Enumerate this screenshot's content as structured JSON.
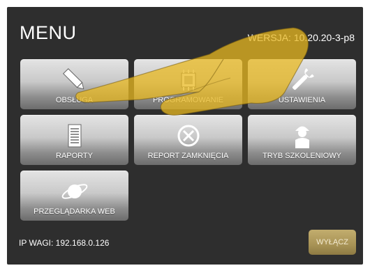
{
  "header": {
    "title": "MENU",
    "version": "WERSJA: 10.20.20-3-p8"
  },
  "tiles": [
    {
      "label": "OBSŁUGA",
      "icon": "pen-icon"
    },
    {
      "label": "PROGRAMOWANIE",
      "icon": "chip-icon"
    },
    {
      "label": "USTAWIENIA",
      "icon": "wrench-icon"
    },
    {
      "label": "RAPORTY",
      "icon": "document-icon"
    },
    {
      "label": "REPORT ZAMKNIĘCIA",
      "icon": "close-circle-icon"
    },
    {
      "label": "TRYB SZKOLENIOWY",
      "icon": "trainee-icon"
    },
    {
      "label": "PRZEGLĄDARKA WEB",
      "icon": "planet-icon"
    }
  ],
  "footer": {
    "ip_label": "IP WAGI: 192.168.0.126",
    "off_label": "WYŁĄCZ"
  },
  "colors": {
    "screen_bg": "#2e2e2e",
    "tile_top": "#e4e4e4",
    "tile_bottom": "#6c6c6c",
    "off_button": "#a89356",
    "hand_overlay": "#e8b820"
  }
}
